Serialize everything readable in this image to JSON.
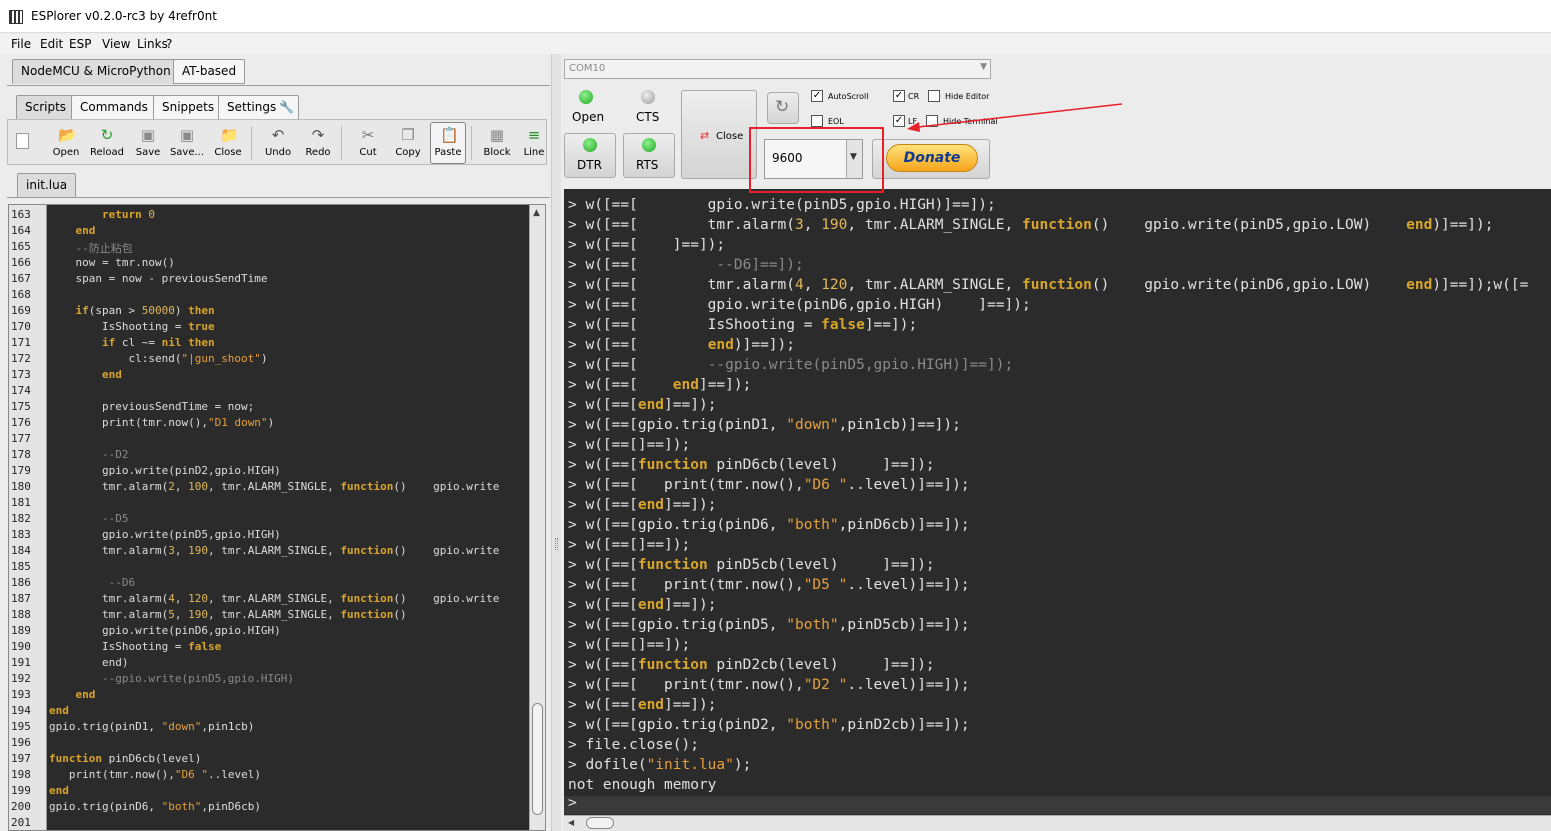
{
  "window": {
    "title": "ESPlorer v0.2.0-rc3 by 4refr0nt"
  },
  "menu": [
    "File",
    "Edit",
    "ESP",
    "View",
    "Links",
    "?"
  ],
  "left": {
    "top_tabs": [
      "NodeMCU & MicroPython",
      "AT-based"
    ],
    "sub_tabs": [
      "Scripts",
      "Commands",
      "Snippets",
      "Settings"
    ],
    "toolbar": [
      "Open",
      "Reload",
      "Save",
      "Save...",
      "Close",
      "Undo",
      "Redo",
      "Cut",
      "Copy",
      "Paste",
      "Block",
      "Line"
    ],
    "file_tab": "init.lua",
    "line_numbers": [
      "163",
      "164",
      "165",
      "166",
      "167",
      "168",
      "169",
      "170",
      "171",
      "172",
      "173",
      "174",
      "175",
      "176",
      "177",
      "178",
      "179",
      "180",
      "181",
      "182",
      "183",
      "184",
      "185",
      "186",
      "187",
      "188",
      "189",
      "190",
      "191",
      "192",
      "193",
      "194",
      "195",
      "196",
      "197",
      "198",
      "199",
      "200",
      "201"
    ]
  },
  "right": {
    "port": "COM10",
    "open_label": "Open",
    "cts_label": "CTS",
    "close_label": "Close",
    "dtr_label": "DTR",
    "rts_label": "RTS",
    "checkboxes": {
      "autoscroll": "AutoScroll",
      "cr": "CR",
      "hide_editor": "Hide Editor",
      "eol": "EOL",
      "lf": "LF",
      "hide_terminal": "Hide Terminal"
    },
    "baud": "9600",
    "donate": "Donate",
    "terminal_plain": [
      "> file.close();",
      "not enough memory",
      ">"
    ]
  },
  "colors": {
    "editor_bg": "#2b2b2b",
    "keyword": "#d9a52b",
    "string": "#e7a03a",
    "comment": "#8a8a8a",
    "highlight": "#e8202a",
    "led": "#2ec52e"
  }
}
